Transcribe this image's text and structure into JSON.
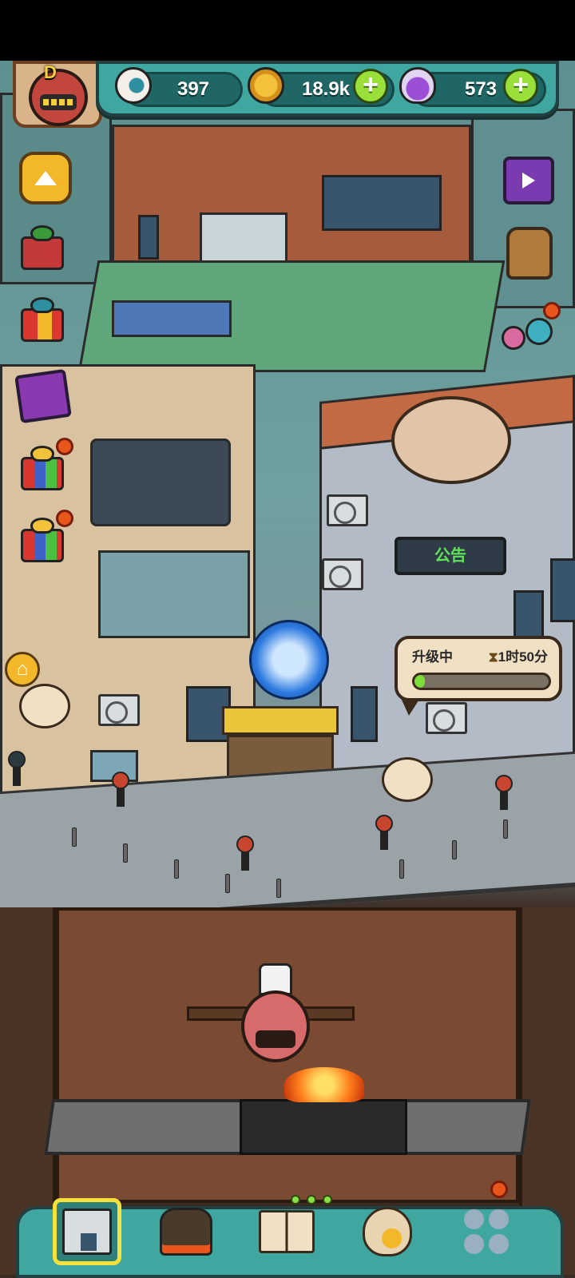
{
  "hud": {
    "rank_letter": "D",
    "eyeballs": "397",
    "coins": "18.9k",
    "potions": "573",
    "add_coins_label": "+",
    "add_potions_label": "+"
  },
  "scene": {
    "notice_sign": "公告"
  },
  "upgrade_panel": {
    "status_label": "升级中",
    "time_remaining": "1时50分",
    "progress": 0.08
  },
  "icons": {
    "eyeball": "eyeball-icon",
    "coin": "coin-icon",
    "potion": "potion-icon",
    "hourglass": "hourglass-icon",
    "home": "home-icon",
    "collapse": "chevron-up-icon"
  },
  "colors": {
    "hud_bg": "#3fa6a0",
    "plus_green": "#9be03a",
    "progress_green": "#7be03a",
    "active_nav": "#f7e23c",
    "notify_dot": "#e8561c"
  },
  "bottom_nav": {
    "active_index": 0,
    "items": [
      "building-tab",
      "monster-tab",
      "book-tab",
      "money-bag-tab",
      "more-tab"
    ]
  }
}
